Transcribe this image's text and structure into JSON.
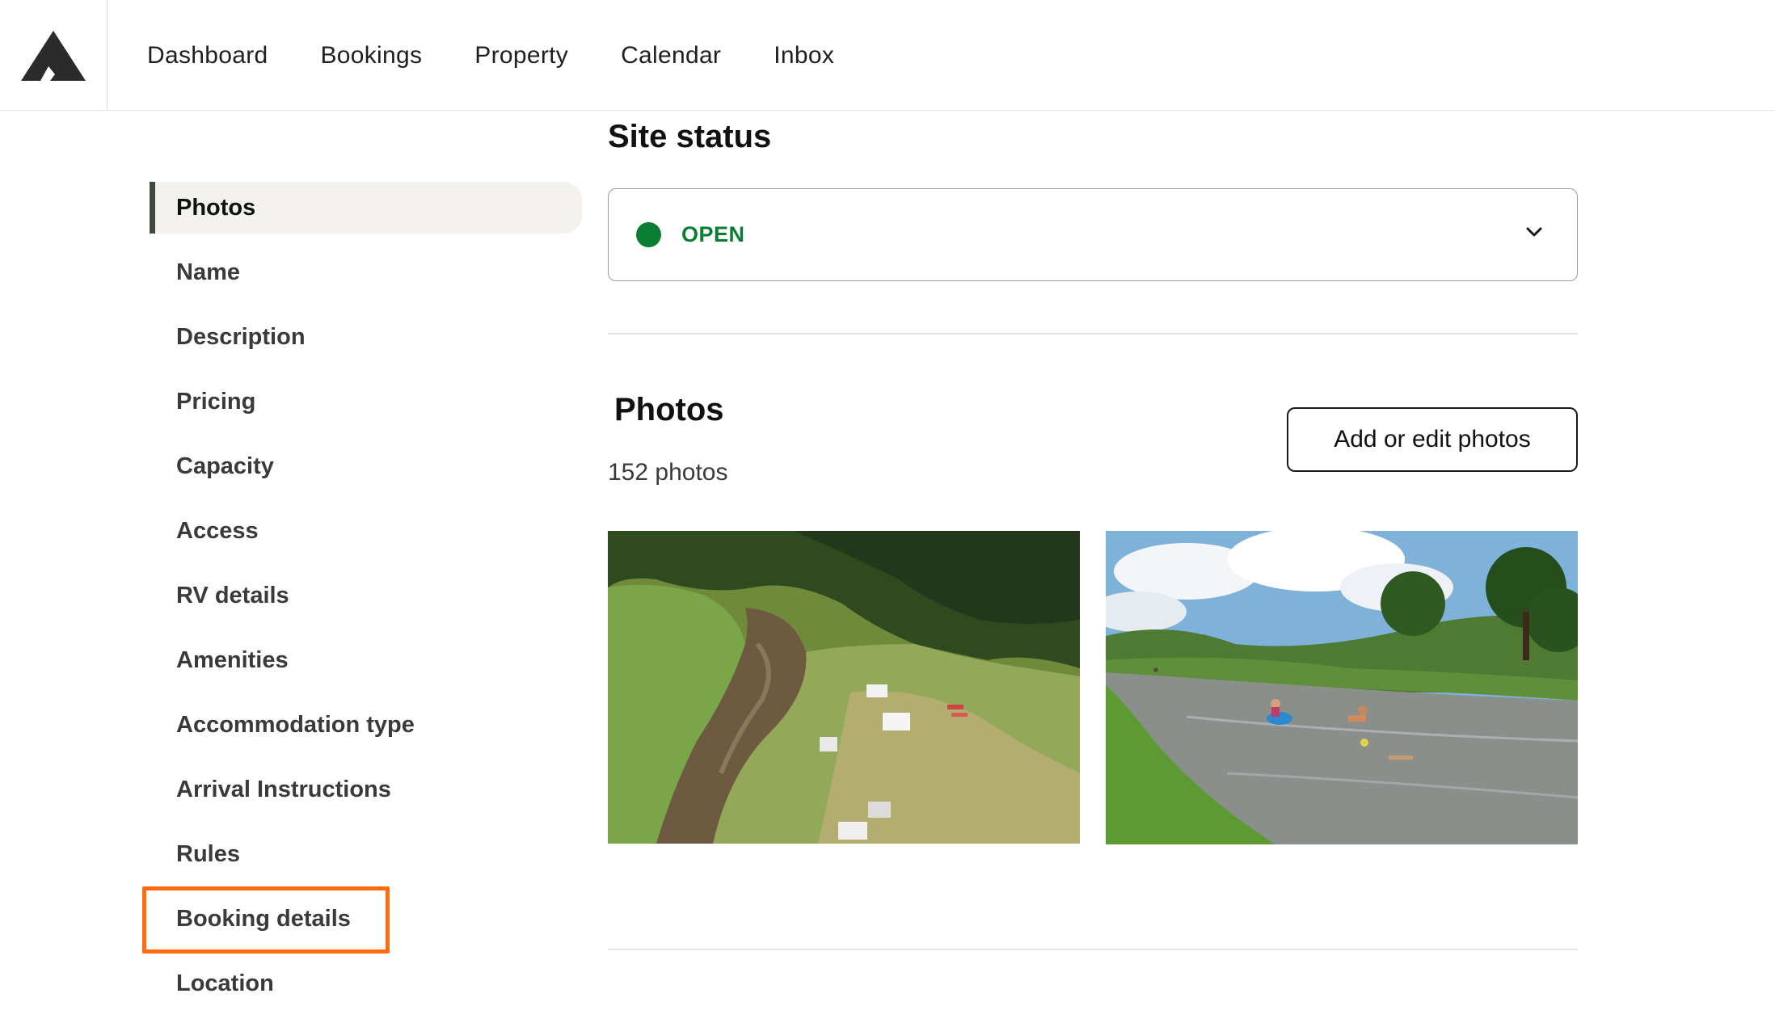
{
  "nav": {
    "logo": "mountain-logo-icon",
    "links": [
      "Dashboard",
      "Bookings",
      "Property",
      "Calendar",
      "Inbox"
    ]
  },
  "sidebar": {
    "items": [
      {
        "label": "Photos",
        "active": true
      },
      {
        "label": "Name"
      },
      {
        "label": "Description"
      },
      {
        "label": "Pricing"
      },
      {
        "label": "Capacity"
      },
      {
        "label": "Access"
      },
      {
        "label": "RV details"
      },
      {
        "label": "Amenities"
      },
      {
        "label": "Accommodation type"
      },
      {
        "label": "Arrival Instructions"
      },
      {
        "label": "Rules"
      },
      {
        "label": "Booking details",
        "highlighted": true
      },
      {
        "label": "Location"
      }
    ]
  },
  "site_status": {
    "heading": "Site status",
    "value": "OPEN",
    "status_color": "#0a7d32"
  },
  "photos": {
    "heading": "Photos",
    "count_text": "152 photos",
    "button_label": "Add or edit photos",
    "images": [
      "aerial-river-campsite-photo",
      "river-kayak-swimmers-photo"
    ]
  },
  "colors": {
    "highlight": "#ff6a13",
    "active_bar": "#3f4a3c",
    "active_bg": "#f3f2ef"
  }
}
